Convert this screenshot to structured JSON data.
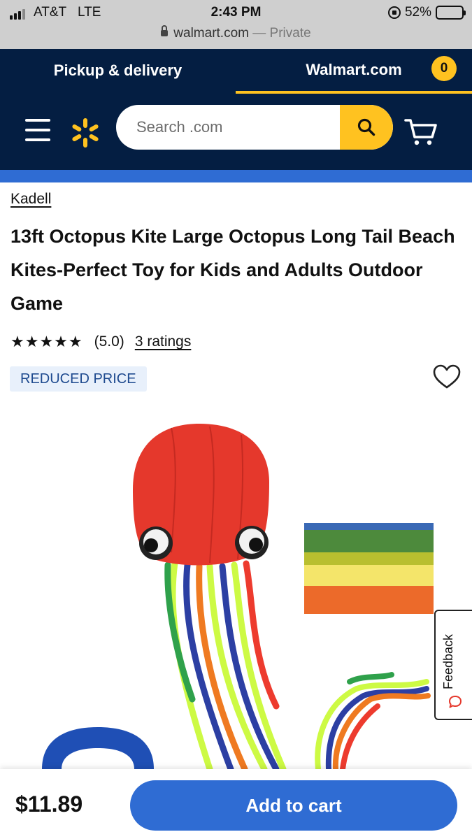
{
  "status_bar": {
    "carrier": "AT&T",
    "network": "LTE",
    "time": "2:43 PM",
    "battery": "52%",
    "battery_level": 0.52
  },
  "address_bar": {
    "domain": "walmart.com",
    "suffix": "— Private"
  },
  "header": {
    "tabs": [
      {
        "label": "Pickup & delivery"
      },
      {
        "label": "Walmart.com"
      }
    ],
    "active_tab": "Walmart.com",
    "search_placeholder": "Search .com",
    "cart_count": "0"
  },
  "product": {
    "brand": "Kadell",
    "title": "13ft Octopus Kite Large Octopus Long Tail Beach Kites-Perfect Toy for Kids and Adults Outdoor Game",
    "stars": "★★★★★",
    "rating": "(5.0)",
    "ratings_count": "3 ratings",
    "badge": "REDUCED PRICE"
  },
  "feedback": {
    "label": "Feedback"
  },
  "bottom_bar": {
    "price": "$11.89",
    "add_to_cart": "Add to cart"
  },
  "colors": {
    "header_bg": "#041e42",
    "accent_yellow": "#ffc220",
    "primary_blue": "#2f6cd3",
    "badge_bg": "#e8f0fb",
    "badge_text": "#1e4a8f"
  },
  "icons": [
    "signal-icon",
    "lock-icon",
    "orientation-lock-icon",
    "battery-icon",
    "menu-icon",
    "walmart-spark-logo",
    "search-icon",
    "cart-icon",
    "heart-icon",
    "chat-bubble-icon"
  ]
}
